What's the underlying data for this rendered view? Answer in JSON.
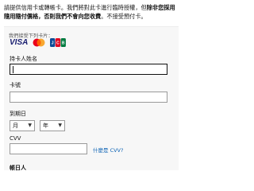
{
  "notice": {
    "part1": "請提供信用卡或轉帳卡。我們將對此卡進行臨時授權，但",
    "bold": "除非您採用隨用隨付價格，否則我們不會向您收費",
    "part2": "。不接受預付卡。"
  },
  "payment_form": {
    "accepted_cards_label": "我們接受下列卡片：",
    "cards": [
      {
        "name": "VISA"
      },
      {
        "name": "Mastercard"
      },
      {
        "name": "JCB"
      }
    ],
    "cardholder_name": {
      "label": "持卡人姓名",
      "value": ""
    },
    "card_number": {
      "label": "卡號",
      "value": ""
    },
    "expiration": {
      "label": "到期日",
      "month": {
        "selected": "月"
      },
      "year": {
        "selected": "年"
      }
    },
    "cvv": {
      "label": "CVV",
      "value": "",
      "help_link": "什麼是 CVV?"
    },
    "next_label_partial": "帳日人"
  },
  "colors": {
    "visa_blue": "#1a1f71",
    "mc_red": "#eb001b",
    "mc_orange": "#f79e1b",
    "link_blue": "#0b62b4"
  },
  "icons": [
    "visa-card-icon",
    "mastercard-card-icon",
    "jcb-card-icon",
    "chevron-down-icon"
  ]
}
